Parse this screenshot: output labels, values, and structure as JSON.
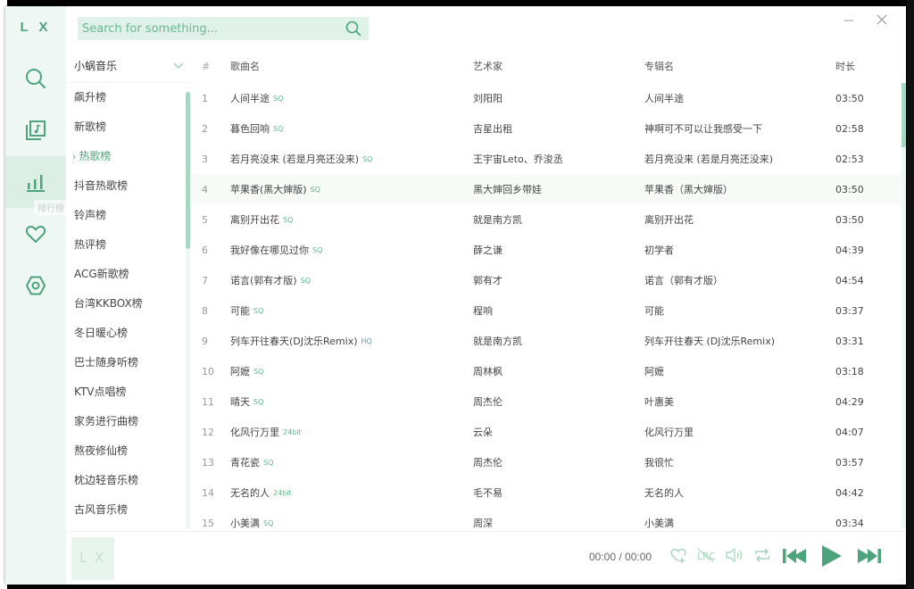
{
  "app": {
    "logo": "L X",
    "window": {
      "minimize_icon": "minimize-icon",
      "close_icon": "close-icon"
    }
  },
  "nav": {
    "items": [
      {
        "id": "search",
        "icon": "search-icon",
        "active": false
      },
      {
        "id": "songlist",
        "icon": "music-list-icon",
        "active": false
      },
      {
        "id": "leaderboard",
        "icon": "bar-chart-icon",
        "active": true,
        "tooltip": "排行榜"
      },
      {
        "id": "favorites",
        "icon": "heart-icon",
        "active": false
      },
      {
        "id": "settings",
        "icon": "settings-icon",
        "active": false
      }
    ]
  },
  "search": {
    "placeholder": "Search for something...",
    "value": ""
  },
  "source": {
    "selected": "小蜗音乐"
  },
  "boards": {
    "active_index": 2,
    "items": [
      "飙升榜",
      "新歌榜",
      "热歌榜",
      "抖音热歌榜",
      "铃声榜",
      "热评榜",
      "ACG新歌榜",
      "台湾KKBOX榜",
      "冬日暖心榜",
      "巴士随身听榜",
      "KTV点唱榜",
      "家务进行曲榜",
      "熬夜修仙榜",
      "枕边轻音乐榜",
      "古风音乐榜"
    ]
  },
  "table": {
    "headers": {
      "num": "#",
      "name": "歌曲名",
      "artist": "艺术家",
      "album": "专辑名",
      "duration": "时长"
    },
    "rows": [
      {
        "num": "1",
        "name": "人间半途",
        "quality": "SQ",
        "artist": "刘阳阳",
        "album": "人间半途",
        "duration": "03:50"
      },
      {
        "num": "2",
        "name": "暮色回响",
        "quality": "SQ",
        "artist": "吉星出租",
        "album": "神啊可不可以让我感受一下",
        "duration": "02:58"
      },
      {
        "num": "3",
        "name": "若月亮没来 (若是月亮还没来)",
        "quality": "SQ",
        "artist": "王宇宙Leto、乔浚丞",
        "album": "若月亮没来 (若是月亮还没来)",
        "duration": "02:53"
      },
      {
        "num": "4",
        "name": "苹果香(黑大婶版)",
        "quality": "SQ",
        "artist": "黑大婶回乡带娃",
        "album": "苹果香（黑大婶版）",
        "duration": "03:50"
      },
      {
        "num": "5",
        "name": "离别开出花",
        "quality": "SQ",
        "artist": "就是南方凯",
        "album": "离别开出花",
        "duration": "03:50"
      },
      {
        "num": "6",
        "name": "我好像在哪见过你",
        "quality": "SQ",
        "artist": "薛之谦",
        "album": "初学者",
        "duration": "04:39"
      },
      {
        "num": "7",
        "name": "诺言(郭有才版)",
        "quality": "SQ",
        "artist": "郭有才",
        "album": "诺言（郭有才版）",
        "duration": "04:54"
      },
      {
        "num": "8",
        "name": "可能",
        "quality": "SQ",
        "artist": "程响",
        "album": "可能",
        "duration": "03:37"
      },
      {
        "num": "9",
        "name": "列车开往春天(DJ沈乐Remix)",
        "quality": "HQ",
        "artist": "就是南方凯",
        "album": "列车开往春天 (DJ沈乐Remix)",
        "duration": "03:31"
      },
      {
        "num": "10",
        "name": "阿嬷",
        "quality": "SQ",
        "artist": "周林枫",
        "album": "阿嬷",
        "duration": "03:18"
      },
      {
        "num": "11",
        "name": "晴天",
        "quality": "SQ",
        "artist": "周杰伦",
        "album": "叶惠美",
        "duration": "04:29"
      },
      {
        "num": "12",
        "name": "化风行万里",
        "quality": "24bit",
        "artist": "云朵",
        "album": "化风行万里",
        "duration": "04:07"
      },
      {
        "num": "13",
        "name": "青花瓷",
        "quality": "SQ",
        "artist": "周杰伦",
        "album": "我很忙",
        "duration": "03:57"
      },
      {
        "num": "14",
        "name": "无名的人",
        "quality": "24bit",
        "artist": "毛不易",
        "album": "无名的人",
        "duration": "04:42"
      },
      {
        "num": "15",
        "name": "小美满",
        "quality": "SQ",
        "artist": "周深",
        "album": "小美满",
        "duration": "03:34"
      }
    ],
    "hovered_row": 3
  },
  "player": {
    "cover_text": "L X",
    "current_time": "00:00",
    "separator": " / ",
    "total_time": "00:00",
    "controls": [
      "add-favorite-icon",
      "lyrics-icon",
      "volume-icon",
      "repeat-icon",
      "previous-icon",
      "play-icon",
      "next-icon"
    ]
  },
  "colors": {
    "accent": "#4da37b",
    "nav_bg": "#eef7f3",
    "search_bg": "#dff1e8",
    "scrollbar": "#a9d8c2"
  }
}
